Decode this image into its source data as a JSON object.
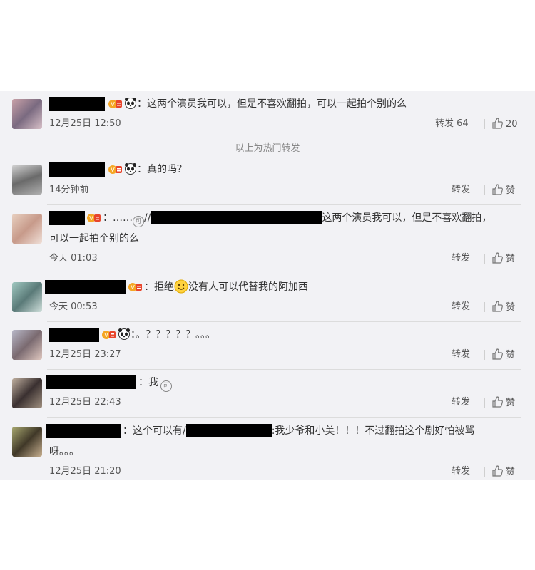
{
  "comments": [
    {
      "text": "：这两个演员我可以，但是不喜欢翻拍，可以一起拍个别的么",
      "time": "12月25日 12:50",
      "repost": "转发 64",
      "like": "20"
    },
    {
      "text": "：真的吗？",
      "time": "14分钟前",
      "repost": "转发",
      "like": "赞"
    },
    {
      "prefix": "：……",
      "slashes": "//",
      "text_a": "这两个演员我可以，但是不喜欢翻拍，",
      "text_b": "可以一起拍个别的么",
      "time": "今天 01:03",
      "repost": "转发",
      "like": "赞"
    },
    {
      "text_a": "：拒绝",
      "text_b": "没有人可以代替我的阿加西",
      "time": "今天 00:53",
      "repost": "转发",
      "like": "赞"
    },
    {
      "text": "：。？？？？？。。。",
      "time": "12月25日 23:27",
      "repost": "转发",
      "like": "赞"
    },
    {
      "text": "：我",
      "time": "12月25日 22:43",
      "repost": "转发",
      "like": "赞"
    },
    {
      "text_a": "：这个可以有/",
      "text_b": ":我少爷和小美！！！不过翻拍这个剧好怕被骂",
      "text_c": "呀。。。",
      "time": "12月25日 21:20",
      "repost": "转发",
      "like": "赞"
    }
  ],
  "hot_divider": "以上为热门转发",
  "icons": {
    "like": "thumbs-up-icon",
    "badge": "vip-badge-icon",
    "panda": "panda-emoji-icon",
    "smile": "smile-emoji-icon",
    "circle": "repost-circle-icon"
  },
  "colors": {
    "panel": "#f2f2f5",
    "redact": "#000000",
    "badge_orange": "#f5a623",
    "badge_red": "#e8452c"
  }
}
